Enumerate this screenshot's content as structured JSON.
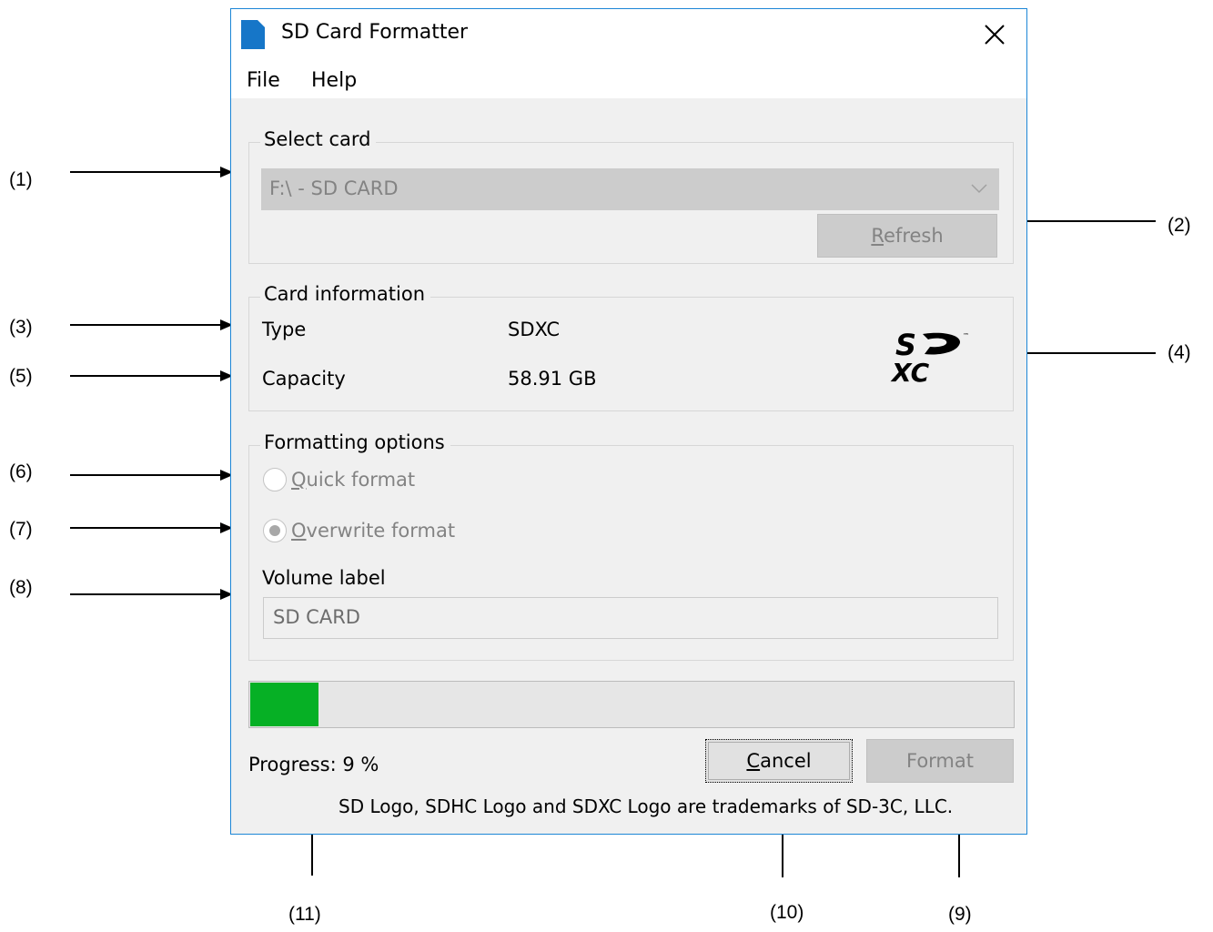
{
  "window": {
    "title": "SD Card Formatter",
    "close_glyph": "✕",
    "accent_color": "#1c86d6"
  },
  "menu": {
    "file": "File",
    "help": "Help"
  },
  "select_card": {
    "legend": "Select card",
    "selected_value": "F:\\ - SD CARD",
    "refresh_first": "R",
    "refresh_rest": "efresh"
  },
  "card_info": {
    "legend": "Card information",
    "type_label": "Type",
    "type_value": "SDXC",
    "capacity_label": "Capacity",
    "capacity_value": "58.91 GB",
    "logo_icon": "sdxc-logo-icon"
  },
  "formatting": {
    "legend": "Formatting options",
    "quick_first": "Q",
    "quick_rest": "uick format",
    "quick_selected": false,
    "overwrite_first": "O",
    "overwrite_rest": "verwrite format",
    "overwrite_selected": true,
    "volume_label": "Volume label",
    "volume_value": "SD CARD"
  },
  "progress": {
    "percent": 9,
    "fill_color": "#06b025",
    "status_text": "Progress: 9 %"
  },
  "buttons": {
    "cancel_first": "C",
    "cancel_rest": "ancel",
    "format": "Format"
  },
  "footer": "SD Logo, SDHC Logo and SDXC Logo are trademarks of SD-3C, LLC.",
  "callouts": {
    "c1": "(1)",
    "c2": "(2)",
    "c3": "(3)",
    "c4": "(4)",
    "c5": "(5)",
    "c6": "(6)",
    "c7": "(7)",
    "c8": "(8)",
    "c9": "(9)",
    "c10": "(10)",
    "c11": "(11)"
  }
}
